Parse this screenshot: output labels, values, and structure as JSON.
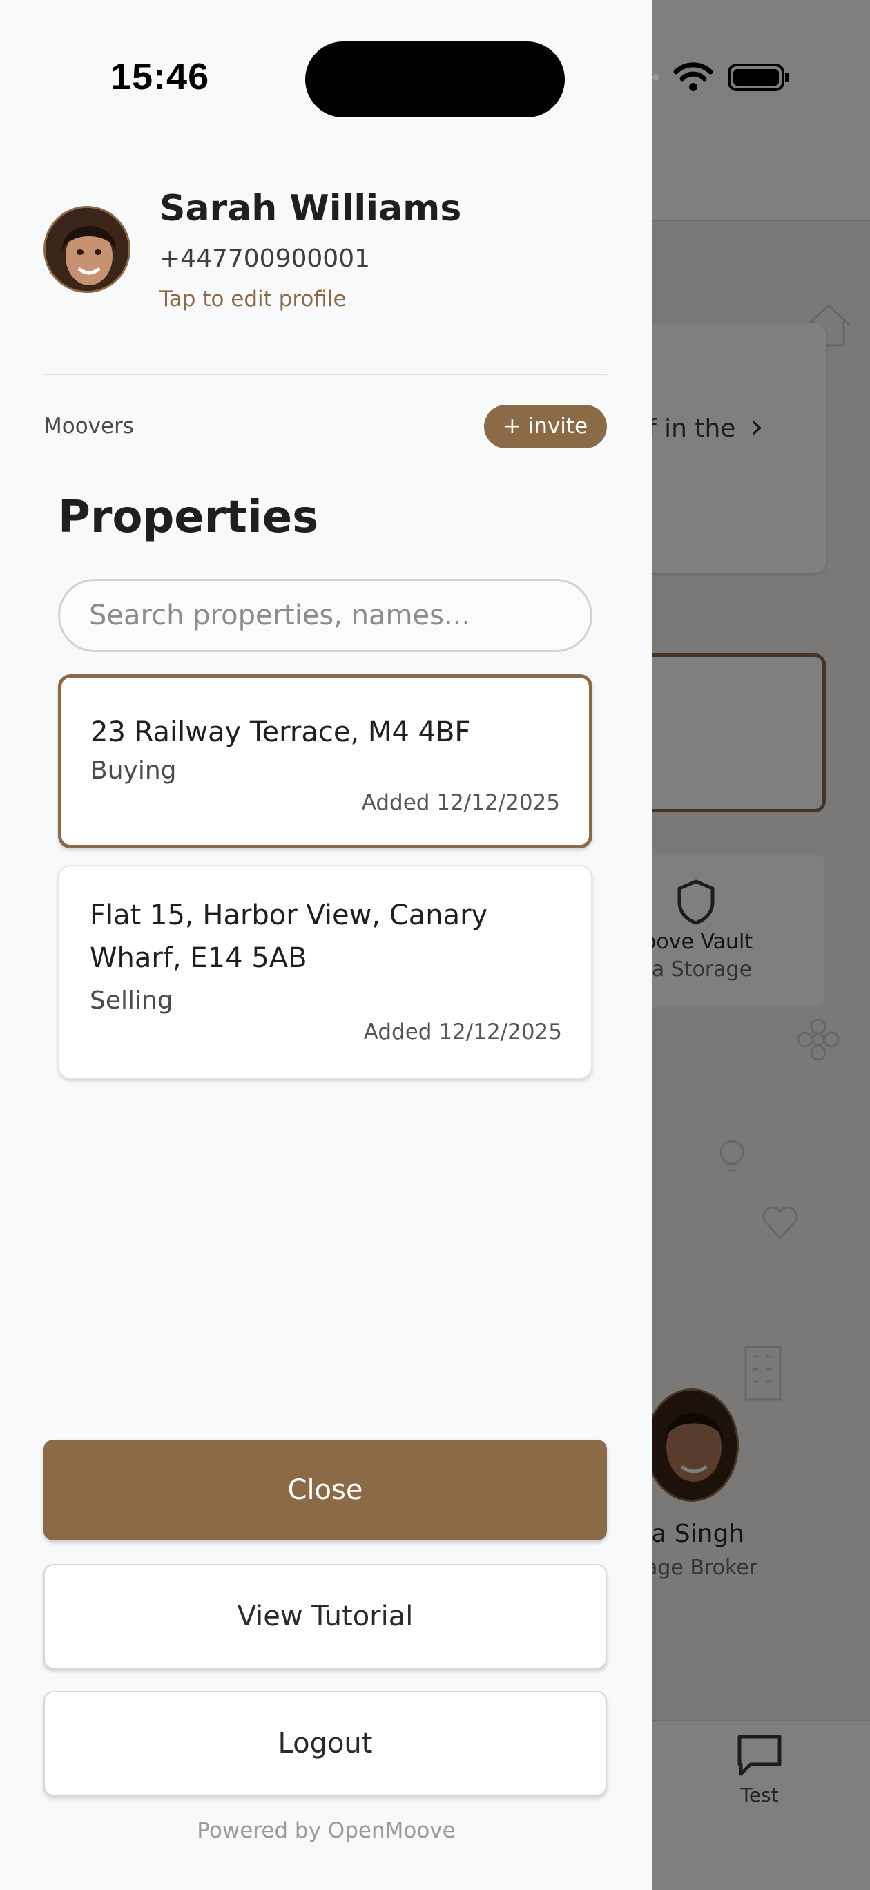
{
  "status_bar": {
    "time": "15:46"
  },
  "profile": {
    "name": "Sarah Williams",
    "phone": "+447700900001",
    "edit_hint": "Tap to edit profile"
  },
  "section": {
    "label": "Moovers",
    "invite_label": "+ invite"
  },
  "properties": {
    "title": "Properties",
    "search_placeholder": "Search properties, names...",
    "items": [
      {
        "address": "23 Railway Terrace, M4 4BF",
        "role": "Buying",
        "added": "Added 12/12/2025",
        "selected": true
      },
      {
        "address": "Flat 15, Harbor View, Canary Wharf, E14 5AB",
        "role": "Selling",
        "added": "Added 12/12/2025",
        "selected": false
      }
    ]
  },
  "actions": {
    "close": "Close",
    "tutorial": "View Tutorial",
    "logout": "Logout"
  },
  "footer": "Powered by OpenMoove",
  "background": {
    "card_text": "f in the",
    "vault_title": "oove Vault",
    "vault_sub": "ta Storage",
    "agent_name": "ya Singh",
    "agent_role": "age Broker",
    "tab_label": "Test"
  },
  "colors": {
    "accent": "#8b6b47",
    "drawer_bg": "#f8f9fb"
  }
}
